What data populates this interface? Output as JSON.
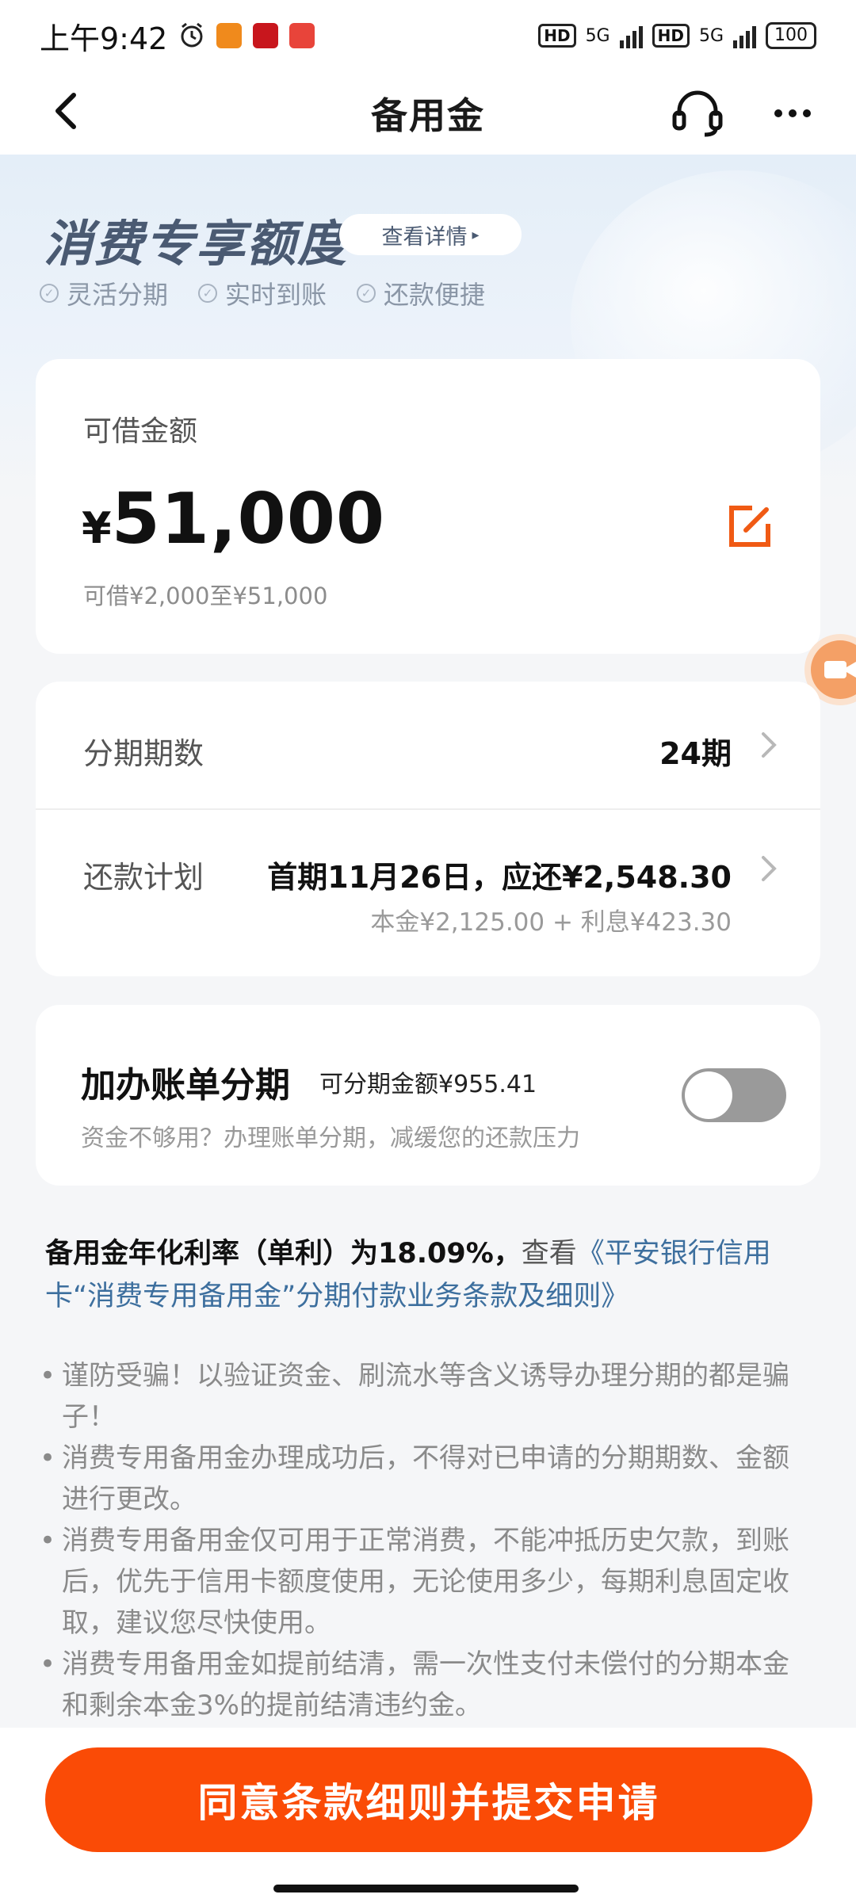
{
  "status_bar": {
    "time": "上午9:42",
    "network1": "5G",
    "network2": "5G",
    "hd_label": "HD",
    "battery": "100"
  },
  "nav": {
    "title": "备用金",
    "back_icon": "chevron-left-icon",
    "support_icon": "headset-icon",
    "more_icon": "more-dots-icon"
  },
  "hero": {
    "title": "消费专享额度",
    "detail_link": "查看详情",
    "features": [
      "灵活分期",
      "实时到账",
      "还款便捷"
    ]
  },
  "amount_card": {
    "label": "可借金额",
    "currency": "¥",
    "amount": "51,000",
    "range": "可借¥2,000至¥51,000",
    "edit_icon": "edit-icon"
  },
  "plan_card": {
    "term_label": "分期期数",
    "term_value": "24期",
    "schedule_label": "还款计划",
    "schedule_value": "首期11月26日，应还¥2,548.30",
    "schedule_detail": "本金¥2,125.00 + 利息¥423.30"
  },
  "bill_card": {
    "title": "加办账单分期",
    "amount": "可分期金额¥955.41",
    "subtitle": "资金不够用？办理账单分期，减缓您的还款压力",
    "toggle_on": false
  },
  "terms": {
    "rate_text": "备用金年化利率（单利）为18.09%，",
    "view_text": "查看",
    "link_text": "《平安银行信用卡“消费专用备用金”分期付款业务条款及细则》"
  },
  "notes": [
    "谨防受骗！以验证资金、刷流水等含义诱导办理分期的都是骗子！",
    "消费专用备用金办理成功后，不得对已申请的分期期数、金额进行更改。",
    "消费专用备用金仅可用于正常消费，不能冲抵历史欠款，到账后，优先于信用卡额度使用，无论使用多少，每期利息固定收取，建议您尽快使用。",
    "消费专用备用金如提前结清，需一次性支付未偿付的分期本金和剩余本金3%的提前结清违约金。"
  ],
  "submit": {
    "label": "同意条款细则并提交申请"
  },
  "colors": {
    "accent": "#fa4b06",
    "link": "#3d6f9e",
    "hero_title": "#4a5a72"
  }
}
